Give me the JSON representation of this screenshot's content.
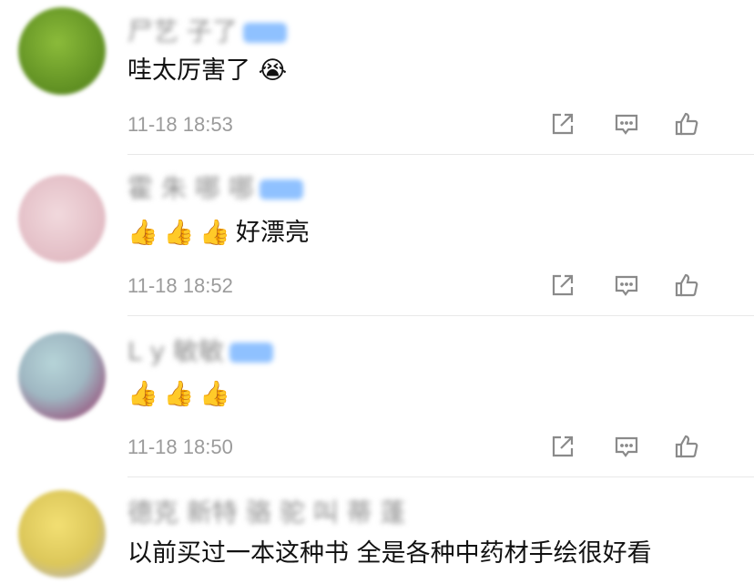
{
  "comments": [
    {
      "name": "尸艺 子了",
      "text": "哇太厉害了",
      "emojis": [
        "😭"
      ],
      "time": "11-18 18:53",
      "avatar_color": "#6f9d2a"
    },
    {
      "name": "霍 朱 哪 哪",
      "text": "好漂亮",
      "emojis": [
        "👍",
        "👍",
        "👍"
      ],
      "time": "11-18 18:52",
      "avatar_color": "#e8c7cd"
    },
    {
      "name": "L  y  敏敏",
      "text": "",
      "emojis": [
        "👍",
        "👍",
        "👍"
      ],
      "time": "11-18 18:50",
      "avatar_color": "#a98bb5"
    },
    {
      "name": "德克 新特 骆 驼 叫 蒂 蓬",
      "text": "以前买过一本这种书 全是各种中药材手绘很好看",
      "emojis": [],
      "time": "",
      "avatar_color": "#e0c75a"
    }
  ],
  "icons": [
    "share-icon",
    "reply-icon",
    "like-icon"
  ],
  "colors": {
    "time": "#9b9b9b",
    "icon": "#8a8a8a",
    "divider": "#e8e8e8",
    "name_tag": "#8fc1ff"
  }
}
